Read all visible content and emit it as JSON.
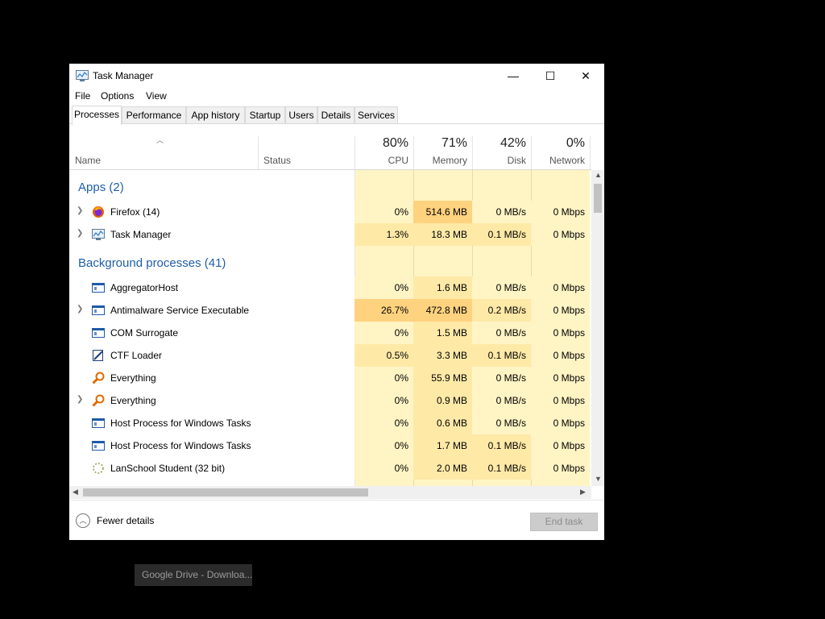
{
  "window": {
    "title": "Task Manager",
    "controls": {
      "minimize": "—",
      "maximize": "☐",
      "close": "✕"
    }
  },
  "menu": [
    "File",
    "Options",
    "View"
  ],
  "tabs": [
    "Processes",
    "Performance",
    "App history",
    "Startup",
    "Users",
    "Details",
    "Services"
  ],
  "active_tab": "Processes",
  "columns": {
    "name": "Name",
    "status": "Status",
    "cpu": {
      "percent": "80%",
      "label": "CPU"
    },
    "memory": {
      "percent": "71%",
      "label": "Memory"
    },
    "disk": {
      "percent": "42%",
      "label": "Disk"
    },
    "network": {
      "percent": "0%",
      "label": "Network"
    }
  },
  "groups": {
    "apps": "Apps (2)",
    "background": "Background processes (41)"
  },
  "apps": [
    {
      "name": "Firefox (14)",
      "icon": "firefox-icon",
      "expandable": true,
      "cpu": "0%",
      "memory": "514.6 MB",
      "disk": "0 MB/s",
      "network": "0 Mbps"
    },
    {
      "name": "Task Manager",
      "icon": "task-manager-icon",
      "expandable": true,
      "cpu": "1.3%",
      "memory": "18.3 MB",
      "disk": "0.1 MB/s",
      "network": "0 Mbps"
    }
  ],
  "background": [
    {
      "name": "AggregatorHost",
      "icon": "window-process-icon",
      "expandable": false,
      "cpu": "0%",
      "memory": "1.6 MB",
      "disk": "0 MB/s",
      "network": "0 Mbps"
    },
    {
      "name": "Antimalware Service Executable",
      "icon": "window-process-icon",
      "expandable": true,
      "cpu": "26.7%",
      "memory": "472.8 MB",
      "disk": "0.2 MB/s",
      "network": "0 Mbps"
    },
    {
      "name": "COM Surrogate",
      "icon": "window-process-icon",
      "expandable": false,
      "cpu": "0%",
      "memory": "1.5 MB",
      "disk": "0 MB/s",
      "network": "0 Mbps"
    },
    {
      "name": "CTF Loader",
      "icon": "pen-icon",
      "expandable": false,
      "cpu": "0.5%",
      "memory": "3.3 MB",
      "disk": "0.1 MB/s",
      "network": "0 Mbps"
    },
    {
      "name": "Everything",
      "icon": "magnifier-icon",
      "expandable": false,
      "cpu": "0%",
      "memory": "55.9 MB",
      "disk": "0 MB/s",
      "network": "0 Mbps"
    },
    {
      "name": "Everything",
      "icon": "magnifier-icon",
      "expandable": true,
      "cpu": "0%",
      "memory": "0.9 MB",
      "disk": "0 MB/s",
      "network": "0 Mbps"
    },
    {
      "name": "Host Process for Windows Tasks",
      "icon": "window-process-icon",
      "expandable": false,
      "cpu": "0%",
      "memory": "0.6 MB",
      "disk": "0 MB/s",
      "network": "0 Mbps"
    },
    {
      "name": "Host Process for Windows Tasks",
      "icon": "window-process-icon",
      "expandable": false,
      "cpu": "0%",
      "memory": "1.7 MB",
      "disk": "0.1 MB/s",
      "network": "0 Mbps"
    },
    {
      "name": "LanSchool Student (32 bit)",
      "icon": "lanschool-icon",
      "expandable": false,
      "cpu": "0%",
      "memory": "2.0 MB",
      "disk": "0.1 MB/s",
      "network": "0 Mbps"
    }
  ],
  "footer": {
    "fewer_details": "Fewer details",
    "end_task": "End task"
  },
  "taskbar_tooltip": "Google Drive - Downloa...",
  "colors": {
    "heat_light": "#fff4c4",
    "heat_mid": "#ffe9a7",
    "heat_strong": "#ffd27f",
    "group_text": "#1f5fa6"
  }
}
